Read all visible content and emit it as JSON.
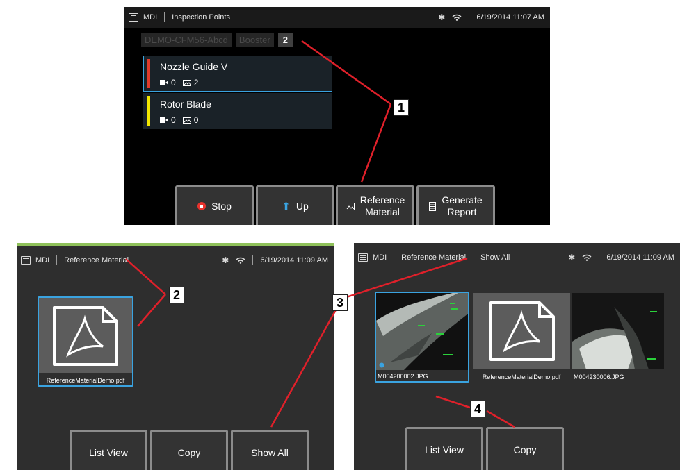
{
  "screen1": {
    "status": {
      "app": "MDI",
      "title": "Inspection Points",
      "datetime": "6/19/2014  11:07 AM"
    },
    "breadcrumbs": [
      "DEMO-CFM56-Abcd",
      "Booster",
      "2"
    ],
    "points": [
      {
        "name": "Nozzle Guide V",
        "videos": "0",
        "images": "2",
        "color": "#e03a2a"
      },
      {
        "name": "Rotor Blade",
        "videos": "0",
        "images": "0",
        "color": "#f2e600"
      }
    ],
    "buttons": {
      "stop": "Stop",
      "up": "Up",
      "reference_line1": "Reference",
      "reference_line2": "Material",
      "report_line1": "Generate",
      "report_line2": "Report"
    }
  },
  "screen2": {
    "status": {
      "app": "MDI",
      "title": "Reference Material",
      "datetime": "6/19/2014  11:09 AM"
    },
    "files": [
      {
        "name": "ReferenceMaterialDemo.pdf",
        "type": "pdf"
      }
    ],
    "buttons": {
      "list_view": "List View",
      "copy": "Copy",
      "show_all": "Show All"
    }
  },
  "screen3": {
    "status": {
      "app": "MDI",
      "title": "Reference Material",
      "filter": "Show All",
      "datetime": "6/19/2014  11:09 AM"
    },
    "files": [
      {
        "name": "M004200002.JPG",
        "type": "image"
      },
      {
        "name": "ReferenceMaterialDemo.pdf",
        "type": "pdf"
      },
      {
        "name": "M004230006.JPG",
        "type": "image"
      }
    ],
    "buttons": {
      "list_view": "List View",
      "copy": "Copy"
    }
  },
  "callouts": [
    "1",
    "2",
    "3",
    "4"
  ],
  "colors": {
    "selection": "#3aa3e0",
    "callout_line": "#e0202a"
  }
}
